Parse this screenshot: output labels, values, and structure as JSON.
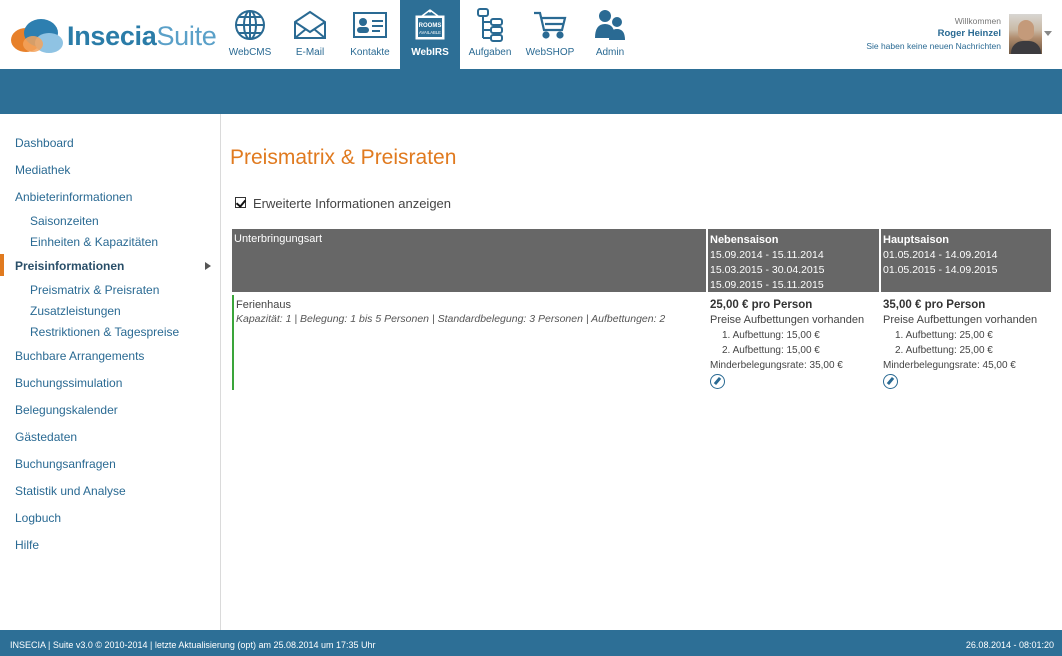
{
  "brand": {
    "name_a": "Insecia",
    "name_b": "Suite"
  },
  "nav": [
    {
      "label": "WebCMS",
      "icon": "globe-icon"
    },
    {
      "label": "E-Mail",
      "icon": "envelope-icon"
    },
    {
      "label": "Kontakte",
      "icon": "contact-card-icon"
    },
    {
      "label": "WebIRS",
      "icon": "rooms-available-icon",
      "badge": "ROOMS AVAILABLE"
    },
    {
      "label": "Aufgaben",
      "icon": "task-tree-icon"
    },
    {
      "label": "WebSHOP",
      "icon": "shopping-cart-icon"
    },
    {
      "label": "Admin",
      "icon": "users-icon"
    }
  ],
  "user": {
    "welcome": "Willkommen",
    "name": "Roger Heinzel",
    "messages": "Sie haben keine neuen Nachrichten"
  },
  "sidebar": {
    "items": [
      {
        "label": "Dashboard"
      },
      {
        "label": "Mediathek"
      },
      {
        "label": "Anbieterinformationen"
      },
      {
        "label": "Saisonzeiten"
      },
      {
        "label": "Einheiten & Kapazitäten"
      },
      {
        "label": "Preisinformationen"
      },
      {
        "label": "Preismatrix & Preisraten"
      },
      {
        "label": "Zusatzleistungen"
      },
      {
        "label": "Restriktionen & Tagespreise"
      },
      {
        "label": "Buchbare Arrangements"
      },
      {
        "label": "Buchungssimulation"
      },
      {
        "label": "Belegungskalender"
      },
      {
        "label": "Gästedaten"
      },
      {
        "label": "Buchungsanfragen"
      },
      {
        "label": "Statistik und Analyse"
      },
      {
        "label": "Logbuch"
      },
      {
        "label": "Hilfe"
      }
    ]
  },
  "main": {
    "title": "Preismatrix & Preisraten",
    "checkbox_label": "Erweiterte Informationen anzeigen",
    "table": {
      "col1_header": "Unterbringungsart",
      "seasons": [
        {
          "name": "Nebensaison",
          "dates": [
            "15.09.2014 - 15.11.2014",
            "15.03.2015 - 30.04.2015",
            "15.09.2015 - 15.11.2015"
          ]
        },
        {
          "name": "Hauptsaison",
          "dates": [
            "01.05.2014 - 14.09.2014",
            "01.05.2015 - 14.09.2015"
          ]
        }
      ],
      "row": {
        "type": "Ferienhaus",
        "details": "Kapazität: 1 | Belegung: 1 bis 5 Personen | Standardbelegung: 3 Personen | Aufbettungen: 2",
        "prices": [
          {
            "price": "25,00 € pro Person",
            "info": "Preise Aufbettungen vorhanden",
            "extra1": "1. Aufbettung: 15,00 €",
            "extra2": "2. Aufbettung: 15,00 €",
            "minder": "Minderbelegungsrate: 35,00 €"
          },
          {
            "price": "35,00 € pro Person",
            "info": "Preise Aufbettungen vorhanden",
            "extra1": "1. Aufbettung: 25,00 €",
            "extra2": "2. Aufbettung: 25,00 €",
            "minder": "Minderbelegungsrate: 45,00 €"
          }
        ]
      }
    }
  },
  "footer": {
    "left": "INSECIA | Suite v3.0 © 2010-2014 | letzte Aktualisierung (opt) am 25.08.2014 um 17:35 Uhr",
    "right": "26.08.2014 - 08:01:20"
  },
  "colors": {
    "accent": "#e07a1f",
    "brand": "#2d6f96",
    "header_gray": "#676767",
    "row_marker": "#3aa53a"
  }
}
